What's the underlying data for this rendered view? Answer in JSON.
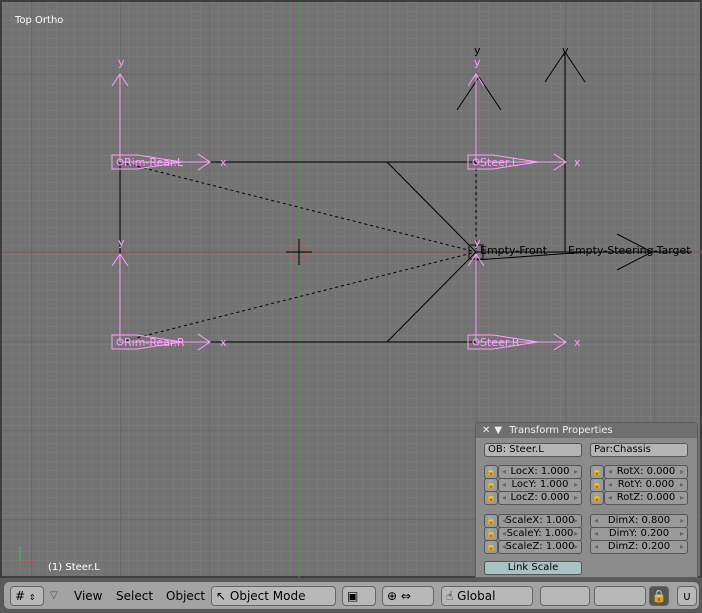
{
  "viewport": {
    "title": "Top Ortho",
    "active_object": "(1) Steer.L",
    "objects": [
      {
        "label": "Rim-Rear.L"
      },
      {
        "label": "Rim-Rear.R"
      },
      {
        "label": "Steer.L"
      },
      {
        "label": "Steer.R"
      },
      {
        "label": "Empty-Front"
      },
      {
        "label": "Empty-Steering-Target"
      }
    ],
    "axis_labels": {
      "x": "x",
      "y": "y"
    },
    "colors": {
      "selected": "#ff9eff",
      "x_axis": "#b04040",
      "y_axis": "#40a040"
    }
  },
  "transform_panel": {
    "title": "Transform Properties",
    "object_name": "OB: Steer.L",
    "parent": "Par:Chassis",
    "loc": [
      "LocX: 1.000",
      "LocY: 1.000",
      "LocZ: 0.000"
    ],
    "rot": [
      "RotX: 0.000",
      "RotY: 0.000",
      "RotZ: 0.000"
    ],
    "scale": [
      "ScaleX: 1.000",
      "ScaleY: 1.000",
      "ScaleZ: 1.000"
    ],
    "dim": [
      "DimX: 0.800",
      "DimY: 0.200",
      "DimZ: 0.200"
    ],
    "link_scale": "Link Scale"
  },
  "header": {
    "menus": [
      "View",
      "Select",
      "Object"
    ],
    "mode": "Object Mode",
    "orientation": "Global"
  }
}
